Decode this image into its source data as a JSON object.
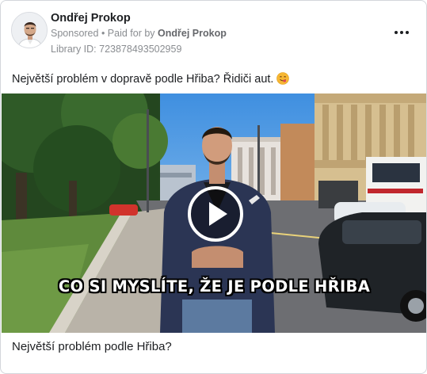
{
  "post": {
    "author": "Ondřej Prokop",
    "sponsored_label": "Sponsored",
    "separator": " • ",
    "paid_prefix": "Paid for by ",
    "paid_by": "Ondřej Prokop",
    "library_id": "Library ID: 723878493502959",
    "text": "Největší problém v dopravě podle Hřiba? Řidiči aut.",
    "emoji_icon": "face-savoring-food-emoji",
    "more_icon": "more-options-icon"
  },
  "video": {
    "caption": "CO SI MYSLÍTE, ŽE JE PODLE HŘIBA",
    "play_icon": "play-icon"
  },
  "footer": {
    "headline": "Největší problém podle Hřiba?"
  }
}
